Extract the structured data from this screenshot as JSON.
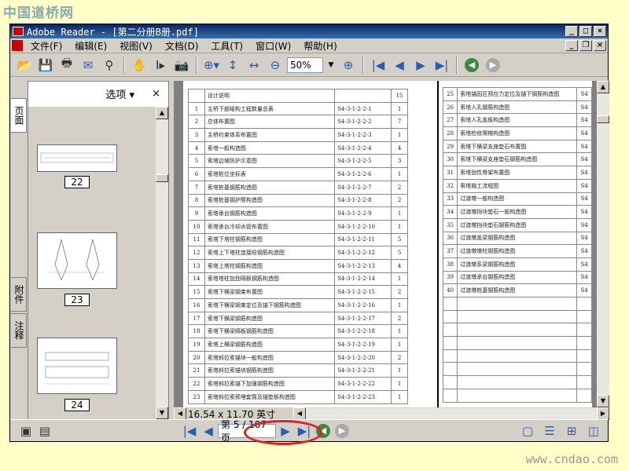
{
  "watermark_top": "中国道桥网",
  "watermark_bottom": "www.cndao.com",
  "window": {
    "title": "Adobe Reader - [第二分册B册.pdf]"
  },
  "menu": [
    "文件(F)",
    "编辑(E)",
    "视图(V)",
    "文档(D)",
    "工具(T)",
    "窗口(W)",
    "帮助(H)"
  ],
  "toolbar": {
    "zoom_value": "50%"
  },
  "side_tabs": [
    "页面",
    "附件",
    "注释"
  ],
  "nav_panel": {
    "options_label": "选项 ▾",
    "close_label": "×",
    "thumb_labels": [
      "22",
      "23",
      "24"
    ]
  },
  "status": {
    "page_size": "16.54 x 11.70 英寸",
    "page_label": "第 5 / 107 页"
  },
  "table_left": [
    [
      "",
      "设计说明",
      "",
      "15"
    ],
    [
      "1",
      "主桥下部结构工程数量总表",
      "S4-3-1-2-2-1",
      "1"
    ],
    [
      "2",
      "总体布置图",
      "S4-3-1-2-2-2",
      "7"
    ],
    [
      "3",
      "主桥约束体系布置图",
      "S4-3-1-2-2-3",
      "1"
    ],
    [
      "4",
      "索塔一般构造图",
      "S4-3-1-2-2-4",
      "4"
    ],
    [
      "5",
      "索塔边坡防护示意图",
      "S4-3-1-2-2-5",
      "3"
    ],
    [
      "6",
      "索塔桩位坐标表",
      "S4-3-1-2-2-6",
      "1"
    ],
    [
      "7",
      "索塔桩基钢筋构造图",
      "S4-3-1-2-2-7",
      "2"
    ],
    [
      "8",
      "索塔桩基钢护筒构造图",
      "S4-3-1-2-2-8",
      "2"
    ],
    [
      "9",
      "索塔承台钢筋构造图",
      "S4-3-1-2-2-9",
      "1"
    ],
    [
      "10",
      "索塔承台冷却水管布置图",
      "S4-3-1-2-2-10",
      "1"
    ],
    [
      "11",
      "索塔下塔柱钢筋构造图",
      "S4-3-1-2-2-11",
      "5"
    ],
    [
      "12",
      "索塔上下塔柱连接段钢筋构造图",
      "S4-3-1-2-2-12",
      "5"
    ],
    [
      "13",
      "索塔上塔柱钢筋构造图",
      "S4-3-1-2-2-13",
      "4"
    ],
    [
      "14",
      "索塔塔柱加劲隔板钢筋构造图",
      "S4-3-1-2-2-14",
      "1"
    ],
    [
      "15",
      "索塔下横梁钢束布置图",
      "S4-3-1-2-2-15",
      "2"
    ],
    [
      "16",
      "索塔下横梁钢束定位及锚下钢筋构造图",
      "S4-3-1-2-2-16",
      "1"
    ],
    [
      "17",
      "索塔下横梁钢筋构造图",
      "S4-3-1-2-2-17",
      "2"
    ],
    [
      "18",
      "索塔下横梁隔板钢筋构造图",
      "S4-3-1-2-2-18",
      "1"
    ],
    [
      "19",
      "索塔上横梁钢筋构造图",
      "S4-3-1-2-2-19",
      "1"
    ],
    [
      "20",
      "索塔斜拉索锚块一般构造图",
      "S4-3-1-2-2-20",
      "2"
    ],
    [
      "21",
      "索塔斜拉索锚块钢筋构造图",
      "S4-3-1-2-2-21",
      "1"
    ],
    [
      "22",
      "索塔斜拉索锚下加强钢筋构造图",
      "S4-3-1-2-2-22",
      "1"
    ],
    [
      "23",
      "索塔斜拉索预埋套筒及锚垫板构造图",
      "S4-3-1-2-2-23",
      "1"
    ]
  ],
  "table_right": [
    [
      "25",
      "索塔锚固区预应力定位及锚下钢筋构造图",
      "S4"
    ],
    [
      "26",
      "索塔人孔钢筋构造图",
      "S4"
    ],
    [
      "27",
      "索塔人孔盖板构造图",
      "S4"
    ],
    [
      "28",
      "索塔检修爬梯构造图",
      "S4"
    ],
    [
      "29",
      "索塔下横梁支座垫石布置图",
      "S4"
    ],
    [
      "30",
      "索塔下横梁支座垫石钢筋构造图",
      "S4"
    ],
    [
      "31",
      "索塔劲性骨架布置图",
      "S4"
    ],
    [
      "32",
      "索塔施工流程图",
      "S4"
    ],
    [
      "33",
      "过渡墩一般构造图",
      "S4"
    ],
    [
      "34",
      "过渡墩挡块垫石一般构造图",
      "S4"
    ],
    [
      "35",
      "过渡墩挡块垫石钢筋构造图",
      "S4"
    ],
    [
      "36",
      "过渡墩盖梁钢筋构造图",
      "S4"
    ],
    [
      "37",
      "过渡墩墩柱钢筋构造图",
      "S4"
    ],
    [
      "38",
      "过渡墩系梁钢筋构造图",
      "S4"
    ],
    [
      "39",
      "过渡墩承台钢筋构造图",
      "S4"
    ],
    [
      "40",
      "过渡墩桩基钢筋构造图",
      "S4"
    ],
    [
      "",
      "",
      ""
    ],
    [
      "",
      "",
      ""
    ],
    [
      "",
      "",
      ""
    ],
    [
      "",
      "",
      ""
    ],
    [
      "",
      "",
      ""
    ],
    [
      "",
      "",
      ""
    ],
    [
      "",
      "",
      ""
    ],
    [
      "",
      "",
      ""
    ]
  ]
}
